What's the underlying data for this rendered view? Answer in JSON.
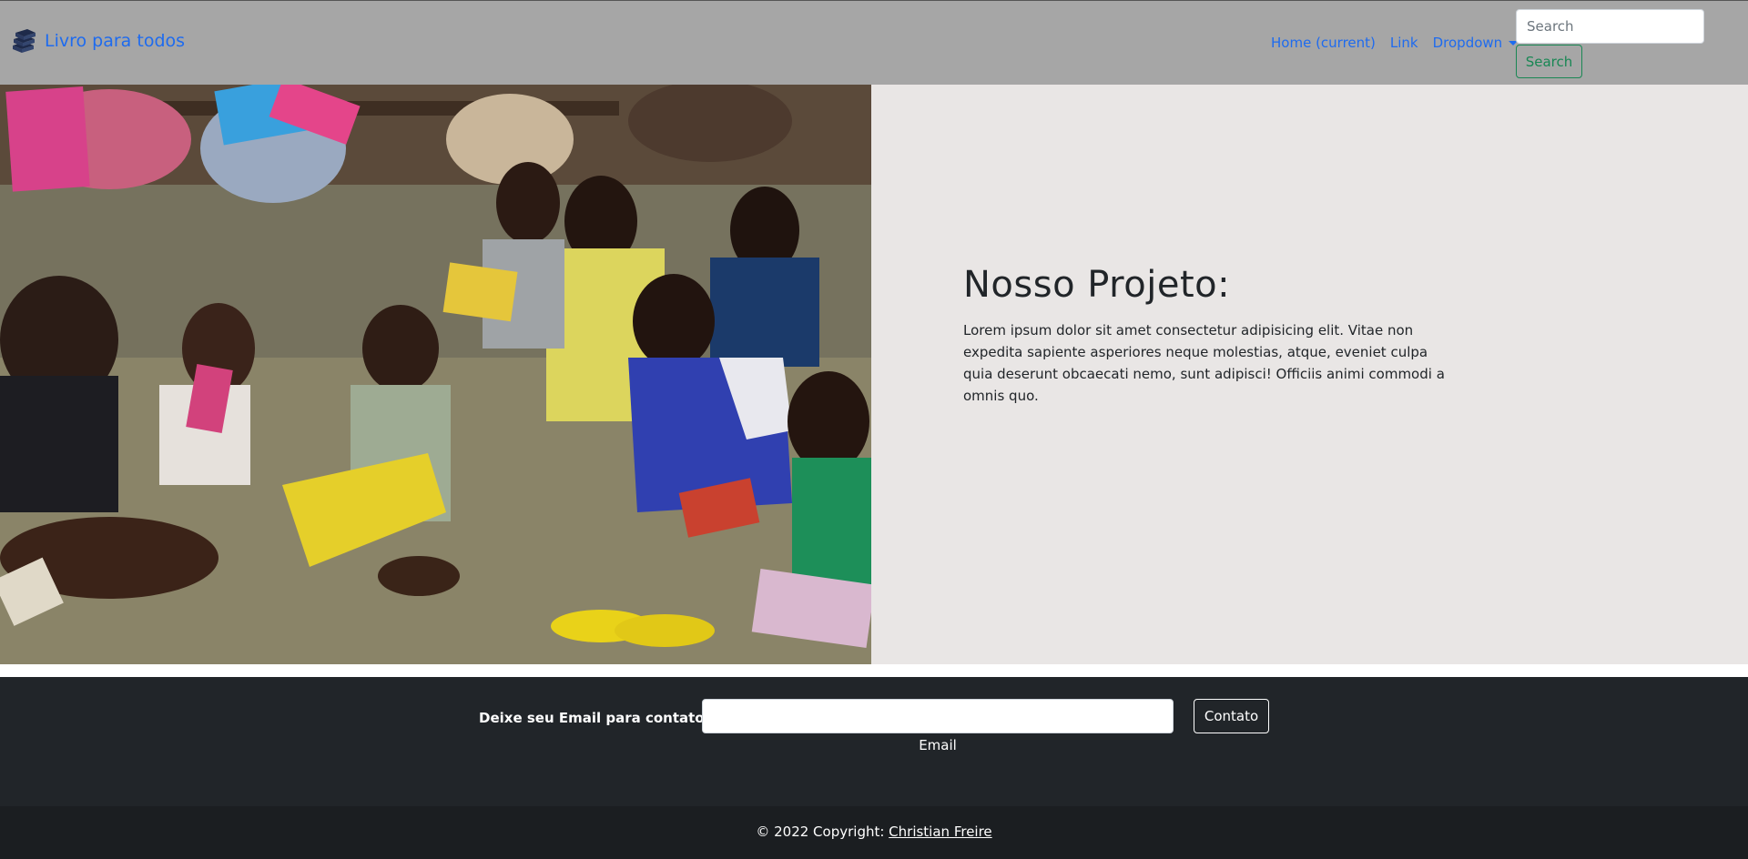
{
  "navbar": {
    "brand_name": "Livro para todos",
    "brand_icon": "books-stack-icon",
    "links": [
      {
        "label": "Home (current)"
      },
      {
        "label": "Link"
      },
      {
        "label": "Dropdown"
      }
    ],
    "search_placeholder": "Search",
    "search_button": "Search"
  },
  "hero": {
    "image_alt": "Children reading books sitting on the floor",
    "title": "Nosso Projeto:",
    "body": "Lorem ipsum dolor sit amet consectetur adipisicing elit. Vitae non expedita sapiente asperiores neque molestias, atque, eveniet culpa quia deserunt obcaecati nemo, sunt adipisci! Officiis animi commodi a omnis quo."
  },
  "contact": {
    "label": "Deixe seu Email para contato:",
    "email_value": "",
    "email_caption": "Email",
    "button": "Contato"
  },
  "footer": {
    "copyright_prefix": "© 2022 Copyright: ",
    "author": "Christian Freire"
  },
  "colors": {
    "navbar_bg": "#a6a6a6",
    "link": "#1e6bef",
    "success": "#198754",
    "hero_bg": "#e9e6e5",
    "dark": "#212529",
    "footer": "#1b1e21"
  }
}
